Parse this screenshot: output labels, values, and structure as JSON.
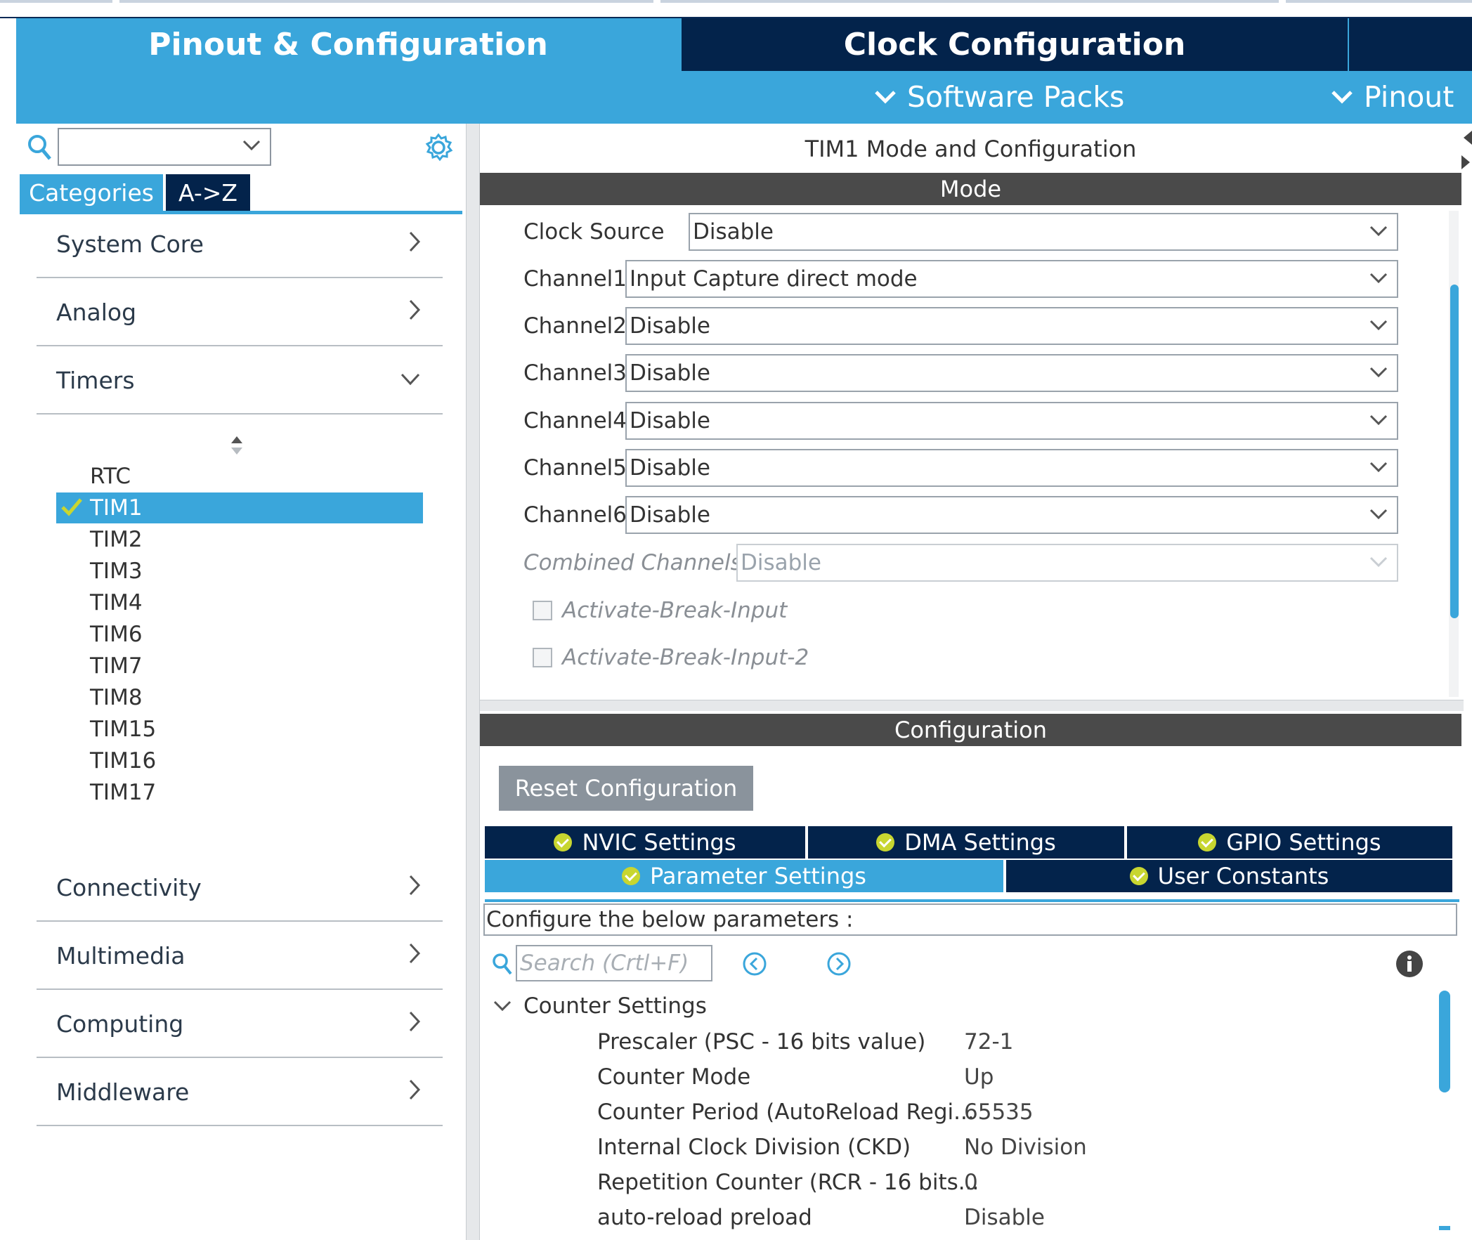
{
  "header": {
    "tabs": [
      {
        "label": "Pinout & Configuration"
      },
      {
        "label": "Clock Configuration"
      }
    ],
    "menus": [
      {
        "label": "Software Packs"
      },
      {
        "label": "Pinout"
      }
    ]
  },
  "sidebar": {
    "search_value": "",
    "view_tabs": [
      {
        "label": "Categories"
      },
      {
        "label": "A->Z"
      }
    ],
    "categories": [
      {
        "label": "System Core"
      },
      {
        "label": "Analog"
      },
      {
        "label": "Timers"
      },
      {
        "label": "Connectivity"
      },
      {
        "label": "Multimedia"
      },
      {
        "label": "Computing"
      },
      {
        "label": "Middleware"
      }
    ],
    "timers": [
      {
        "label": "RTC"
      },
      {
        "label": "TIM1"
      },
      {
        "label": "TIM2"
      },
      {
        "label": "TIM3"
      },
      {
        "label": "TIM4"
      },
      {
        "label": "TIM6"
      },
      {
        "label": "TIM7"
      },
      {
        "label": "TIM8"
      },
      {
        "label": "TIM15"
      },
      {
        "label": "TIM16"
      },
      {
        "label": "TIM17"
      }
    ],
    "selected_timer": "TIM1"
  },
  "mode_panel": {
    "title": "TIM1 Mode and Configuration",
    "section": "Mode",
    "rows": [
      {
        "label": "Clock Source",
        "value": "Disable"
      },
      {
        "label": "Channel1",
        "value": "Input Capture direct mode"
      },
      {
        "label": "Channel2",
        "value": "Disable"
      },
      {
        "label": "Channel3",
        "value": "Disable"
      },
      {
        "label": "Channel4",
        "value": "Disable"
      },
      {
        "label": "Channel5",
        "value": "Disable"
      },
      {
        "label": "Channel6",
        "value": "Disable"
      },
      {
        "label": "Combined Channels",
        "value": "Disable"
      }
    ],
    "checkboxes": [
      {
        "label": "Activate-Break-Input",
        "checked": false
      },
      {
        "label": "Activate-Break-Input-2",
        "checked": false
      }
    ]
  },
  "config_panel": {
    "section": "Configuration",
    "reset_label": "Reset Configuration",
    "tabs_row1": [
      {
        "label": "NVIC Settings"
      },
      {
        "label": "DMA Settings"
      },
      {
        "label": "GPIO Settings"
      }
    ],
    "tabs_row2": [
      {
        "label": "Parameter Settings"
      },
      {
        "label": "User Constants"
      }
    ],
    "active_tab": "Parameter Settings",
    "description": "Configure the below parameters :",
    "search_placeholder": "Search (Crtl+F)",
    "group_title": "Counter Settings",
    "params": [
      {
        "name": "Prescaler (PSC - 16 bits value)",
        "value": "72-1"
      },
      {
        "name": "Counter Mode",
        "value": "Up"
      },
      {
        "name": "Counter Period (AutoReload Regi...",
        "value": "65535"
      },
      {
        "name": "Internal Clock Division (CKD)",
        "value": "No Division"
      },
      {
        "name": "Repetition Counter (RCR - 16 bits...",
        "value": "0"
      },
      {
        "name": "auto-reload preload",
        "value": "Disable"
      }
    ]
  },
  "colors": {
    "primary_blue": "#3aa6db",
    "navy": "#03234b",
    "dark_bar": "#4a4a4a",
    "check_green": "#c8d630"
  }
}
